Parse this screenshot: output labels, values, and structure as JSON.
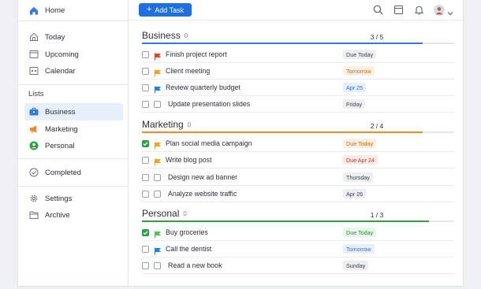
{
  "sidebar": {
    "top_items": [
      {
        "label": "Home",
        "icon": "home-icon"
      },
      {
        "label": "Today",
        "icon": "today-icon"
      },
      {
        "label": "Upcoming",
        "icon": "upcoming-icon"
      },
      {
        "label": "Calendar",
        "icon": "calendar-icon"
      }
    ],
    "lists_label": "Lists",
    "lists": [
      {
        "label": "Business",
        "icon": "briefcase-icon",
        "color": "#3478e0",
        "active": true
      },
      {
        "label": "Marketing",
        "icon": "megaphone-icon",
        "color": "#f08a24"
      },
      {
        "label": "Personal",
        "icon": "person-icon",
        "color": "#2f9e44"
      }
    ],
    "completed": {
      "label": "Completed",
      "icon": "check-circle-icon"
    },
    "bottom_items": [
      {
        "label": "Settings",
        "icon": "gear-icon"
      },
      {
        "label": "Archive",
        "icon": "archive-icon"
      }
    ]
  },
  "topbar": {
    "add_task_label": "Add Task",
    "icons": [
      "search-icon",
      "board-icon",
      "bell-icon",
      "avatar",
      "chevron-down-icon"
    ]
  },
  "sections": [
    {
      "title": "Business",
      "count": "0",
      "progress_text": "3 / 5",
      "progress": 0.9,
      "color": "#3478e0",
      "tasks": [
        {
          "title": "Finish project report",
          "due": "Due Today",
          "due_style": "gray",
          "flag": "#e0442c",
          "checked": false,
          "extra_box": false
        },
        {
          "title": "Client meeting",
          "due": "Tomorrow",
          "due_style": "orange",
          "flag": "#f0a030",
          "checked": false,
          "extra_box": false
        },
        {
          "title": "Review quarterly budget",
          "due": "Apr 25",
          "due_style": "blue",
          "flag": "#2a7de0",
          "checked": false,
          "extra_box": false
        },
        {
          "title": "Update presentation slides",
          "due": "Friday",
          "due_style": "gray",
          "flag": "",
          "checked": false,
          "extra_box": true
        }
      ]
    },
    {
      "title": "Marketing",
      "count": "0",
      "progress_text": "2 / 4",
      "progress": 0.9,
      "color": "#f08a24",
      "tasks": [
        {
          "title": "Plan social media campaign",
          "due": "Due Today",
          "due_style": "orange",
          "flag": "#f0a030",
          "checked": true,
          "extra_box": false
        },
        {
          "title": "Write blog post",
          "due": "Due Apr 24",
          "due_style": "red",
          "flag": "#f0a030",
          "checked": false,
          "extra_box": false
        },
        {
          "title": "Design new ad banner",
          "due": "Thursday",
          "due_style": "gray",
          "flag": "",
          "checked": false,
          "extra_box": true
        },
        {
          "title": "Analyze website traffic",
          "due": "Apr 26",
          "due_style": "gray",
          "flag": "",
          "checked": false,
          "extra_box": true
        }
      ]
    },
    {
      "title": "Personal",
      "count": "0",
      "progress_text": "1 / 3",
      "progress": 0.92,
      "color": "#2f9e44",
      "tasks": [
        {
          "title": "Buy groceries",
          "due": "Due Today",
          "due_style": "green",
          "flag": "#58c05a",
          "checked": true,
          "extra_box": false
        },
        {
          "title": "Call the dentist",
          "due": "Tomorrow",
          "due_style": "blue",
          "flag": "#2a7de0",
          "checked": false,
          "extra_box": false
        },
        {
          "title": "Read a new book",
          "due": "Sunday",
          "due_style": "gray",
          "flag": "",
          "checked": false,
          "extra_box": true
        }
      ]
    }
  ]
}
